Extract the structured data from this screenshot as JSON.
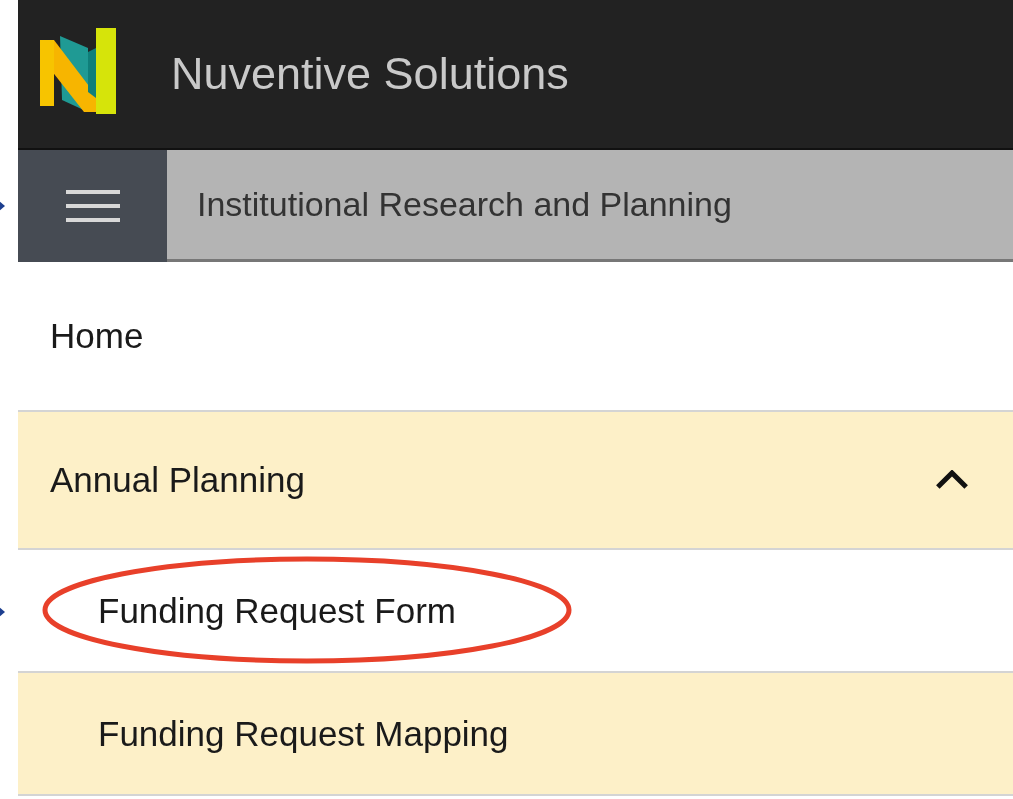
{
  "header": {
    "title": "Nuventive Solutions"
  },
  "nav_bar": {
    "title": "Institutional Research and Planning",
    "pointer": true
  },
  "menu": [
    {
      "label": "Home",
      "highlighted": false
    },
    {
      "label": "Annual Planning",
      "highlighted": true,
      "expanded": true,
      "children": [
        {
          "label": "Funding Request Form",
          "highlighted": false,
          "circled": true,
          "pointer": true
        },
        {
          "label": "Funding Request Mapping",
          "highlighted": true,
          "circled": false,
          "pointer": false
        }
      ]
    }
  ]
}
